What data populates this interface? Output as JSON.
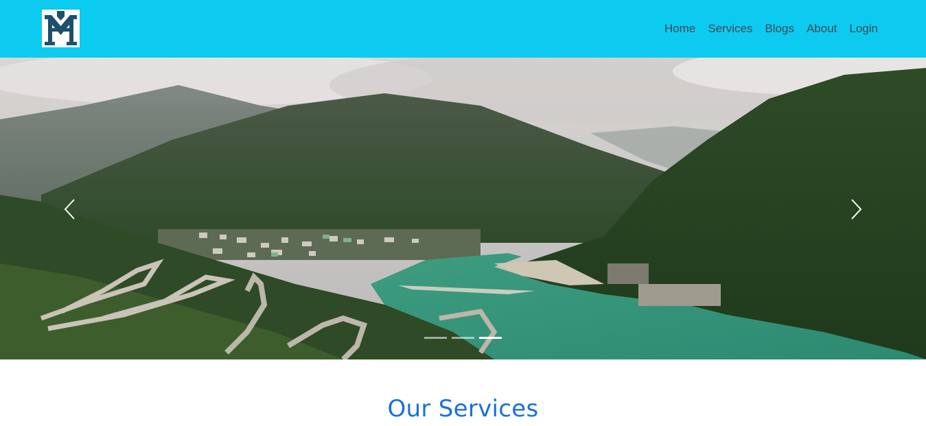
{
  "navbar": {
    "logo": {
      "icon": "mh-monogram-logo",
      "letters": "MH"
    },
    "links": [
      "Home",
      "Services",
      "Blogs",
      "About",
      "Login"
    ],
    "color": "#0dcaf0"
  },
  "carousel": {
    "slides_count": 3,
    "active_index": 2,
    "prev_icon": "chevron-left-icon",
    "next_icon": "chevron-right-icon"
  },
  "services": {
    "title": "Our Services",
    "title_color": "#1a6fe0"
  }
}
